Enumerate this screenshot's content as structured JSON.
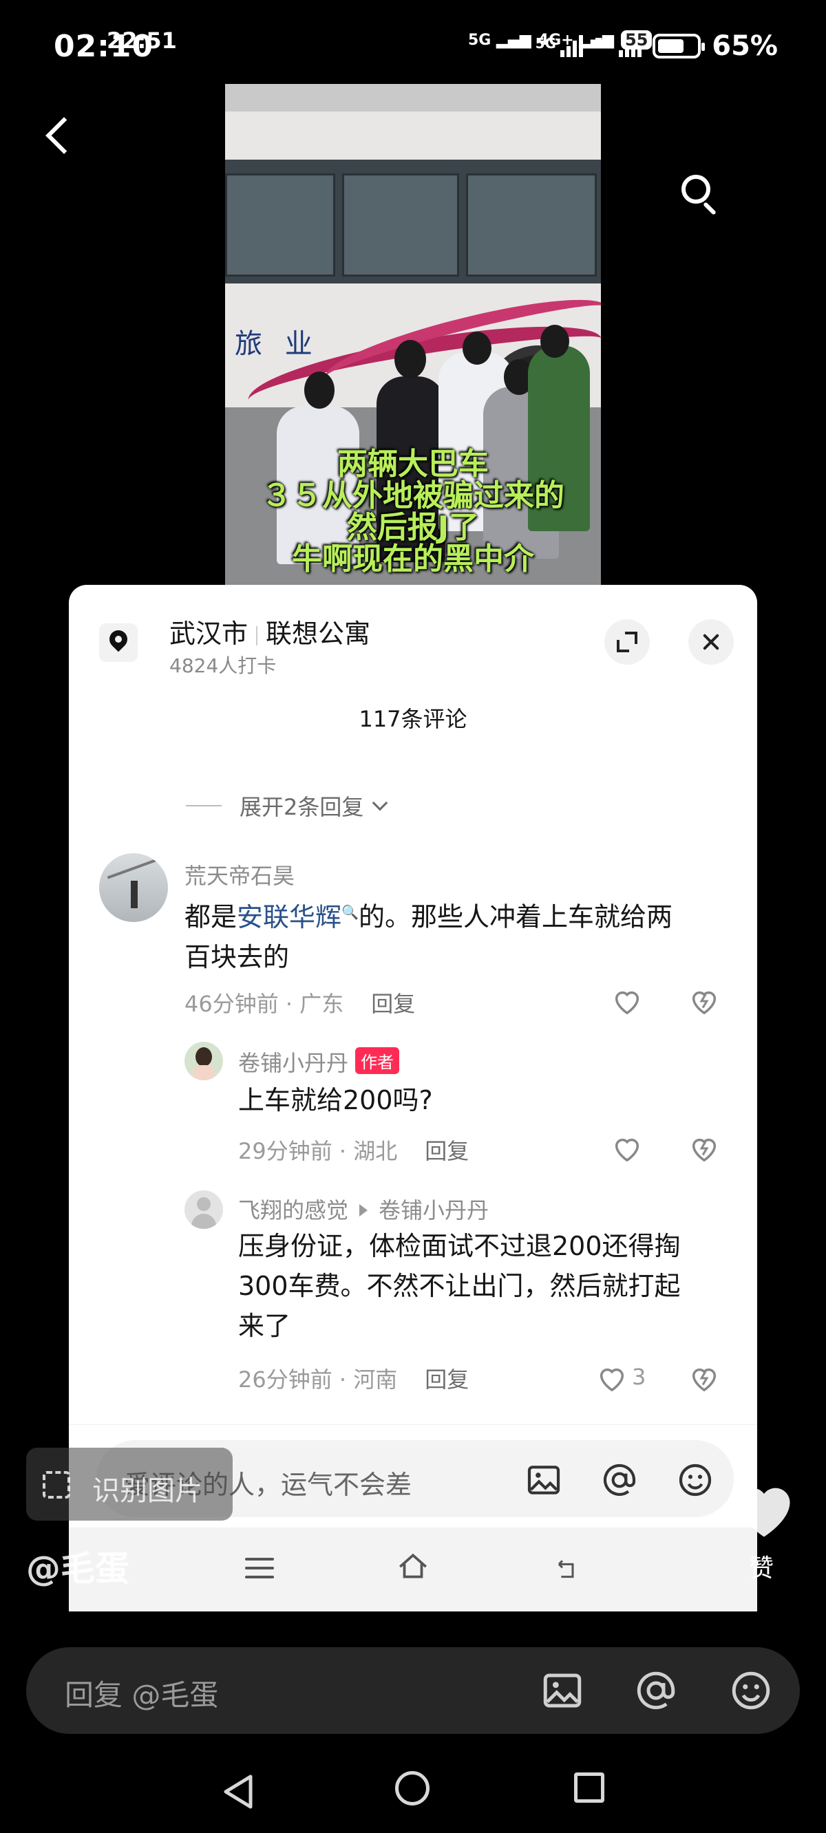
{
  "status_bar": {
    "time": "02:10",
    "net1": "5G",
    "net2": "5G",
    "battery": "65%"
  },
  "video": {
    "inner_time": "22:51",
    "inner_battery": "55",
    "bus_text": "旅 业",
    "caption_lines": [
      "两辆大巴车",
      "３５从外地被骗过来的",
      "然后报J了",
      "牛啊现在的黑中介"
    ]
  },
  "sheet": {
    "location_city": "武汉市",
    "location_place": "联想公寓",
    "checkins": "4824人打卡",
    "comment_count": "117条评论",
    "expand_replies": "展开2条回复",
    "comments": [
      {
        "name": "荒天帝石昊",
        "text_before": "都是",
        "link": "安联华辉",
        "text_line1_after": "的。那些人冲着上车就给两",
        "text_line2": "百块去的",
        "time": "46分钟前 · 广东",
        "reply": "回复"
      },
      {
        "name": "卷铺小丹丹",
        "author_tag": "作者",
        "text": "上车就给200吗?",
        "time": "29分钟前 · 湖北",
        "reply": "回复"
      },
      {
        "name": "飞翔的感觉",
        "reply_to": "卷铺小丹丹",
        "text_lines": [
          "压身份证，体检面试不过退200还得掏",
          "300车费。不然不让出门，然后就打起",
          "来了"
        ],
        "time": "26分钟前 · 河南",
        "reply": "回复",
        "likes": "3"
      }
    ],
    "input_placeholder": "爱评论的人，运气不会差"
  },
  "overlay": {
    "recognize_image": "识别图片",
    "user_handle": "@毛蛋",
    "like_label": "赞"
  },
  "reply_bar": {
    "placeholder": "回复 @毛蛋"
  },
  "colors": {
    "accent": "#fe2c55",
    "link": "#2a5189",
    "caption": "#b8ef5a"
  },
  "icons": [
    "back-icon",
    "search-icon",
    "location-pin-icon",
    "expand-icon",
    "close-icon",
    "heart-icon",
    "dislike-icon",
    "image-icon",
    "at-icon",
    "emoji-icon",
    "menu-icon",
    "home-icon",
    "return-icon",
    "scan-icon"
  ]
}
